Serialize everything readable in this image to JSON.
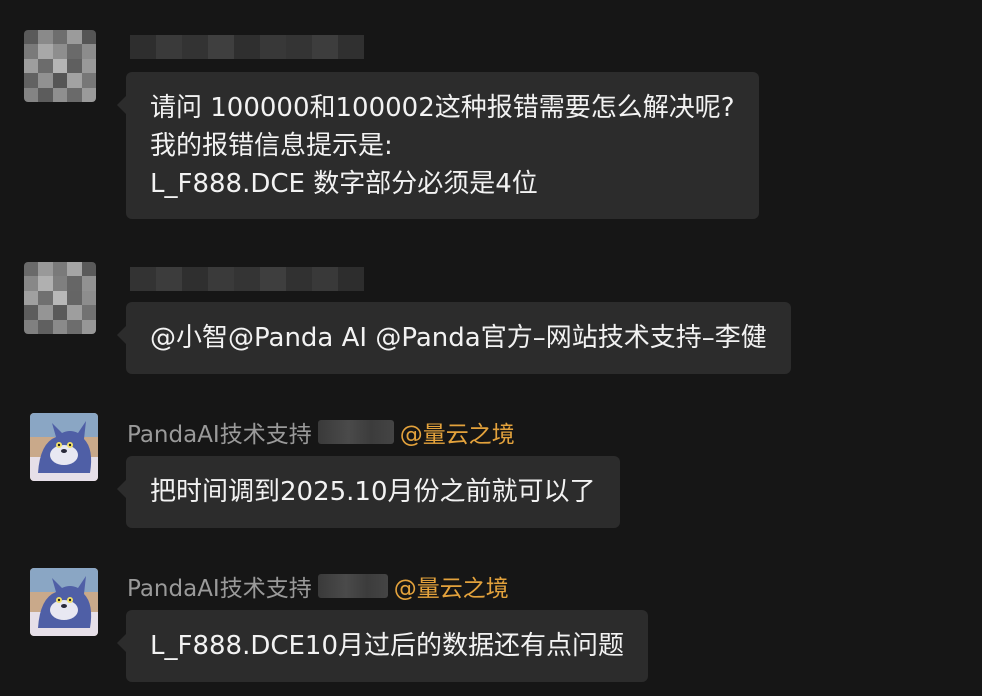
{
  "messages": [
    {
      "sender": "",
      "lines": [
        "请问 100000和100002这种报错需要怎么解决呢?",
        "我的报错信息提示是:",
        "L_F888.DCE 数字部分必须是4位"
      ]
    },
    {
      "sender": "",
      "lines": [
        "@小智@Panda AI @Panda官方–网站技术支持–李健"
      ]
    },
    {
      "sender": "PandaAI技术支持",
      "mention": "@量云之境",
      "lines": [
        "把时间调到2025.10月份之前就可以了"
      ]
    },
    {
      "sender": "PandaAI技术支持",
      "mention": "@量云之境",
      "lines": [
        "L_F888.DCE10月过后的数据还有点问题"
      ]
    }
  ],
  "colors": {
    "background": "#161616",
    "bubble": "#2c2c2c",
    "text": "#f2f2f2",
    "sender": "#9a9a9a",
    "mention": "#e3a23c"
  },
  "icons": {
    "avatar_blurred": "pixelated-avatar",
    "avatar_bot": "tom-cat-avatar"
  }
}
